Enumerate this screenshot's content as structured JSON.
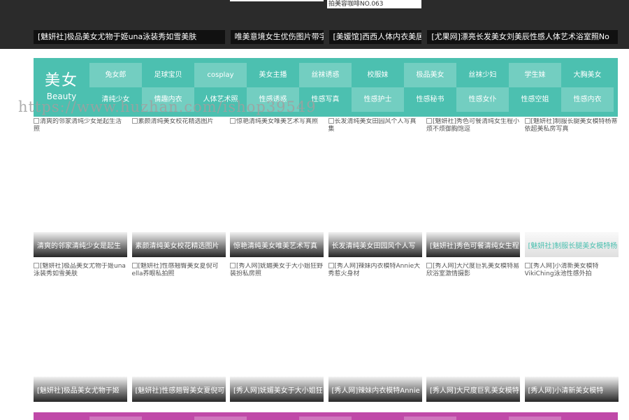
{
  "top": {
    "snippet": "拍美容咖啡NO.063",
    "links": [
      "[魅妍社]极品美女尤物于姬una泳装秀如雪美肤",
      "唯美意境女生优伤图片带字",
      "[美媛馆]西西人体内衣美居朱",
      "[尤果网]漂亮长发美女刘美辰性感人体艺术浴室照No"
    ]
  },
  "category": {
    "brand_cn": "美女",
    "brand_en": "Beauty",
    "items": [
      "兔女郎",
      "足球宝贝",
      "cosplay",
      "美女主播",
      "丝袜诱惑",
      "校服妹",
      "极品美女",
      "丝袜少妇",
      "学生妹",
      "大胸美女",
      "清纯少女",
      "情趣内衣",
      "人体艺术照",
      "性感诱惑",
      "性感写真",
      "性感护士",
      "性感秘书",
      "性感女仆",
      "性感空姐",
      "性感内衣"
    ]
  },
  "watermark": "https://www.huzhan.com/ishop39549",
  "cards_row1": [
    {
      "alt": "清爽的邻家清纯少女是起生活照",
      "caption": "清爽的邻家清纯少女是起生"
    },
    {
      "alt": "素颜清纯美女校花精选图片",
      "caption": "素颜清纯美女校花精选图片"
    },
    {
      "alt": "惊艳清纯美女唯美艺术写真照",
      "caption": "惊艳清纯美女唯美艺术写真"
    },
    {
      "alt": "长发清纯美女田园风个人写真集",
      "caption": "长发清纯美女田园风个人写"
    },
    {
      "alt": "[魅妍社]秀色可餐清纯女生程小烦不烦御胸饱逗",
      "caption": "[魅妍社]秀色可餐清纯女生程"
    },
    {
      "alt": "[魅妍社]制服长腿美女模特杨蒂依超美私房写真",
      "caption": "[魅妍社]制服长腿美女模特杨"
    }
  ],
  "cards_row2": [
    {
      "alt": "[魅妍社]极品美女尤物于姬una泳装秀如雪美肤",
      "caption": "[魅妍社]极品美女尤物于姬"
    },
    {
      "alt": "[魅妍社]性感翘臀美女夏倪可ella养眼私拍照",
      "caption": "[魅妍社]性感翘臀美女夏倪可"
    },
    {
      "alt": "[秀人网]妩媚美女于大小姐狂野装扮私房照",
      "caption": "[秀人网]妩媚美女于大小姐狂"
    },
    {
      "alt": "[秀人网]辣妹内衣模特Annie大秀惹火身材",
      "caption": "[秀人网]辣妹内衣模特Annie"
    },
    {
      "alt": "[秀人网]大尺度巨乳美女模特易欣浴室激情摄影",
      "caption": "[秀人网]大尺度巨乳美女模特"
    },
    {
      "alt": "[秀人网]小清新美女模特VikiChing泳池性感外拍",
      "caption": "[秀人网]小清新美女模特"
    }
  ],
  "colors": {
    "topbar": "#2b2b2b",
    "teal": "#4cc0b0",
    "pink": "#c04aa8"
  }
}
